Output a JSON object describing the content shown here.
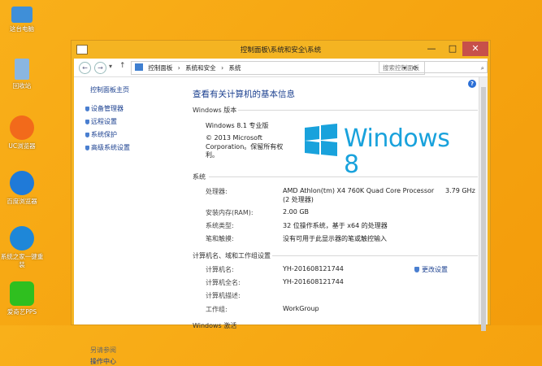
{
  "desktop": {
    "icons": [
      {
        "label": "这台电脑",
        "icon": "computer-icon",
        "color": "#3f8fd8"
      },
      {
        "label": "回收站",
        "icon": "recycle-bin-icon",
        "color": "#8ab6e0"
      },
      {
        "label": "UC浏览器",
        "icon": "uc-browser-icon",
        "color": "#f26a1b"
      },
      {
        "label": "百度浏览器",
        "icon": "baidu-browser-icon",
        "color": "#1f7ad8"
      },
      {
        "label": "系统之家一键重装",
        "icon": "system-reinstall-icon",
        "color": "#1e87d8"
      },
      {
        "label": "爱奇艺PPS",
        "icon": "iqiyi-pps-icon",
        "color": "#2fbf1f"
      }
    ]
  },
  "window": {
    "title": "控制面板\\系统和安全\\系统",
    "min": "—",
    "max": "□",
    "close": "✕"
  },
  "addressbar": {
    "back": "←",
    "forward": "→",
    "dropdown": "▾",
    "up": "↑",
    "crumbs": [
      "控制面板",
      "›",
      "系统和安全",
      "›",
      "系统"
    ],
    "refresh": "⟳",
    "search_placeholder": "搜索控制面板",
    "search_icon": "⌕"
  },
  "leftpane": {
    "home": "控制面板主页",
    "links": [
      "设备管理器",
      "远程设置",
      "系统保护",
      "高级系统设置"
    ],
    "see_also": "另请参阅",
    "more": "操作中心"
  },
  "help": "?",
  "main": {
    "title": "查看有关计算机的基本信息",
    "edition_section": "Windows 版本",
    "edition_name": "Windows 8.1 专业版",
    "copyright_1": "© 2013 Microsoft",
    "copyright_2": "Corporation。保留所有权",
    "copyright_3": "利。",
    "logo_text": "Windows 8",
    "system_section": "系统",
    "system_rows": [
      {
        "label": "处理器:",
        "value": "AMD Athlon(tm) X4 760K Quad Core Processor",
        "value2": "3.79 GHz"
      },
      {
        "label": "",
        "value": "(2 处理器)",
        "value2": ""
      },
      {
        "label": "安装内存(RAM):",
        "value": "2.00 GB",
        "value2": ""
      },
      {
        "label": "系统类型:",
        "value": "32 位操作系统，基于 x64 的处理器",
        "value2": ""
      },
      {
        "label": "笔和触摸:",
        "value": "没有可用于此显示器的笔或触控输入",
        "value2": ""
      }
    ],
    "name_section": "计算机名、域和工作组设置",
    "name_rows": [
      {
        "label": "计算机名:",
        "value": "YH-20160812174​4"
      },
      {
        "label": "计算机全名:",
        "value": "YH-20160812174​4"
      },
      {
        "label": "计算机描述:",
        "value": ""
      },
      {
        "label": "工作组:",
        "value": "WorkGroup"
      }
    ],
    "change_settings": "更改设置",
    "next_section": "Windows 激活"
  }
}
